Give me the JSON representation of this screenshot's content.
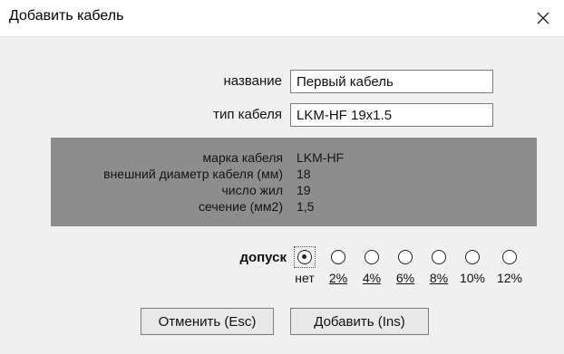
{
  "window": {
    "title": "Добавить кабель",
    "close_icon": "close-icon"
  },
  "form": {
    "name_label": "название",
    "name_value": "Первый кабель",
    "type_label": "тип кабеля",
    "type_value": "LKM-HF 19x1.5"
  },
  "info": {
    "background": "#8d8d8d",
    "rows": [
      {
        "key": "марка кабеля",
        "value": "LKM-HF"
      },
      {
        "key": "внешний диаметр кабеля (мм)",
        "value": "18"
      },
      {
        "key": "число жил",
        "value": "19"
      },
      {
        "key": "сечение (мм2)",
        "value": "1,5"
      }
    ]
  },
  "tolerance": {
    "label": "допуск",
    "options": [
      {
        "label": "нет",
        "selected": true
      },
      {
        "label": "2%",
        "selected": false
      },
      {
        "label": "4%",
        "selected": false
      },
      {
        "label": "6%",
        "selected": false
      },
      {
        "label": "8%",
        "selected": false
      },
      {
        "label": "10%",
        "selected": false
      },
      {
        "label": "12%",
        "selected": false
      }
    ]
  },
  "buttons": {
    "cancel_label": "Отменить (Esc)",
    "add_label": "Добавить (Ins)"
  }
}
